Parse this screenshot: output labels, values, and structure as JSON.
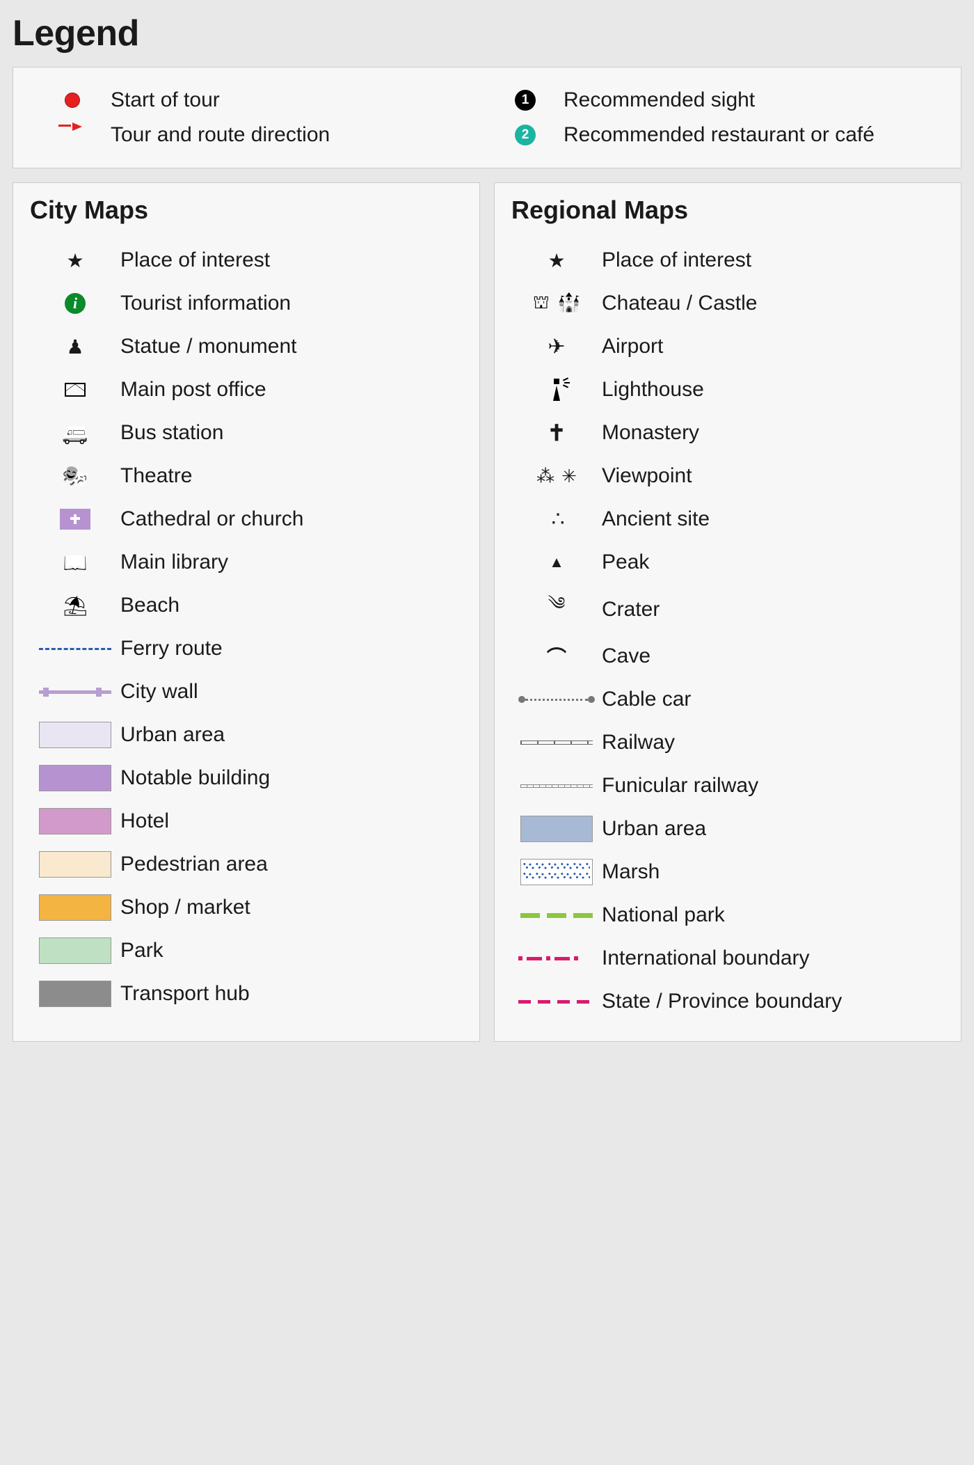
{
  "title": "Legend",
  "top": {
    "left": [
      {
        "id": "start-of-tour",
        "icon": "dot-red",
        "label": "Start of tour"
      },
      {
        "id": "tour-direction",
        "icon": "tour-line",
        "label": "Tour and route direction"
      }
    ],
    "right": [
      {
        "id": "rec-sight",
        "icon": "num-black",
        "num": "1",
        "label": "Recommended sight"
      },
      {
        "id": "rec-resto",
        "icon": "num-teal",
        "num": "2",
        "label": "Recommended restaurant or café"
      }
    ]
  },
  "city": {
    "heading": "City Maps",
    "items": [
      {
        "id": "poi-city",
        "icon": "star",
        "label": "Place of interest"
      },
      {
        "id": "tourist-info",
        "icon": "info",
        "label": "Tourist information"
      },
      {
        "id": "statue",
        "icon": "statue",
        "label": "Statue / monument"
      },
      {
        "id": "post-office",
        "icon": "envelope",
        "label": "Main post office"
      },
      {
        "id": "bus",
        "icon": "bus",
        "label": "Bus station"
      },
      {
        "id": "theatre",
        "icon": "theatre",
        "label": "Theatre"
      },
      {
        "id": "church",
        "icon": "church",
        "label": "Cathedral or church"
      },
      {
        "id": "library",
        "icon": "library",
        "label": "Main library"
      },
      {
        "id": "beach",
        "icon": "beach",
        "label": "Beach"
      },
      {
        "id": "ferry",
        "icon": "ferry",
        "label": "Ferry route"
      },
      {
        "id": "city-wall",
        "icon": "citywall",
        "label": "City wall"
      },
      {
        "id": "urban-city",
        "icon": "swatch",
        "swatch": "urban-city",
        "label": "Urban area"
      },
      {
        "id": "notable-building",
        "icon": "swatch",
        "swatch": "notable-building",
        "label": "Notable building"
      },
      {
        "id": "hotel",
        "icon": "swatch",
        "swatch": "hotel",
        "label": "Hotel"
      },
      {
        "id": "pedestrian",
        "icon": "swatch",
        "swatch": "pedestrian",
        "label": "Pedestrian area"
      },
      {
        "id": "shop",
        "icon": "swatch",
        "swatch": "shop",
        "label": "Shop / market"
      },
      {
        "id": "park",
        "icon": "swatch",
        "swatch": "park",
        "label": "Park"
      },
      {
        "id": "transport",
        "icon": "swatch",
        "swatch": "transport",
        "label": "Transport hub"
      }
    ]
  },
  "region": {
    "heading": "Regional Maps",
    "items": [
      {
        "id": "poi-region",
        "icon": "star",
        "label": "Place of interest"
      },
      {
        "id": "chateau",
        "icon": "chateau",
        "label": "Chateau / Castle"
      },
      {
        "id": "airport",
        "icon": "airplane",
        "label": "Airport"
      },
      {
        "id": "lighthouse",
        "icon": "lighthouse",
        "label": "Lighthouse"
      },
      {
        "id": "monastery",
        "icon": "monastery",
        "label": "Monastery"
      },
      {
        "id": "viewpoint",
        "icon": "viewpoint",
        "label": "Viewpoint"
      },
      {
        "id": "ancient",
        "icon": "ancient",
        "label": "Ancient site"
      },
      {
        "id": "peak",
        "icon": "peak",
        "label": "Peak"
      },
      {
        "id": "crater",
        "icon": "crater",
        "label": "Crater"
      },
      {
        "id": "cave",
        "icon": "cave",
        "label": "Cave"
      },
      {
        "id": "cablecar",
        "icon": "cablecar",
        "label": "Cable car"
      },
      {
        "id": "railway",
        "icon": "railway",
        "label": "Railway"
      },
      {
        "id": "funicular",
        "icon": "funicular",
        "label": "Funicular railway"
      },
      {
        "id": "urban-region",
        "icon": "swatch",
        "swatch": "urban-region",
        "label": "Urban area"
      },
      {
        "id": "marsh",
        "icon": "swatch",
        "swatch": "marsh",
        "label": "Marsh"
      },
      {
        "id": "natpark",
        "icon": "natpark",
        "label": "National park"
      },
      {
        "id": "intl-boundary",
        "icon": "intl",
        "label": "International boundary"
      },
      {
        "id": "state-boundary",
        "icon": "state",
        "label": "State / Province boundary"
      }
    ]
  }
}
